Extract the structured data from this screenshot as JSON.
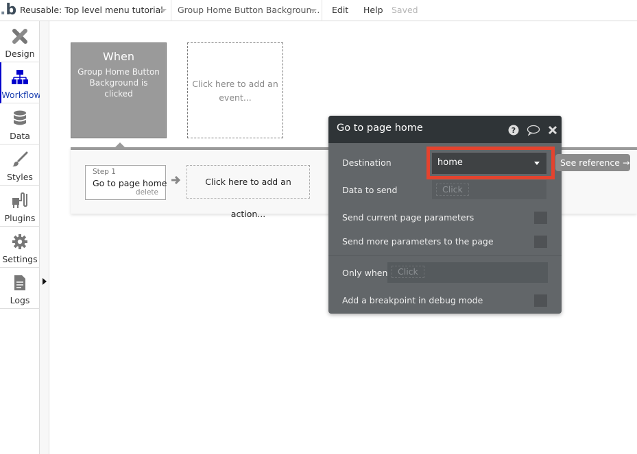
{
  "topbar": {
    "logo": "b",
    "page_selector": "Reusable: Top level menu tutorial",
    "element_selector": "Group Home Button Backgroun...",
    "menu_edit": "Edit",
    "menu_help": "Help",
    "status": "Saved"
  },
  "sidebar": {
    "items": [
      {
        "label": "Design",
        "icon": "design-icon"
      },
      {
        "label": "Workflow",
        "icon": "workflow-icon",
        "active": true
      },
      {
        "label": "Data",
        "icon": "database-icon"
      },
      {
        "label": "Styles",
        "icon": "brush-icon"
      },
      {
        "label": "Plugins",
        "icon": "plug-icon"
      },
      {
        "label": "Settings",
        "icon": "gear-icon"
      },
      {
        "label": "Logs",
        "icon": "document-icon"
      }
    ]
  },
  "workflow": {
    "event": {
      "title": "When",
      "description": "Group Home Button Background is clicked"
    },
    "add_event": "Click here to add an event...",
    "steps": [
      {
        "step_label": "Step 1",
        "name": "Go to page home",
        "delete_label": "delete"
      }
    ],
    "add_action": "Click here to add an action..."
  },
  "property_editor": {
    "title": "Go to page home",
    "icons": [
      "help-icon",
      "comment-icon",
      "close-icon"
    ],
    "destination_label": "Destination",
    "destination_value": "home",
    "data_to_send_label": "Data to send",
    "data_to_send_placeholder": "Click",
    "send_current_params_label": "Send current page parameters",
    "send_more_params_label": "Send more parameters to the page",
    "only_when_label": "Only when",
    "only_when_placeholder": "Click",
    "breakpoint_label": "Add a breakpoint in debug mode",
    "see_reference": "See reference →",
    "highlight_color": "#e4432e"
  }
}
